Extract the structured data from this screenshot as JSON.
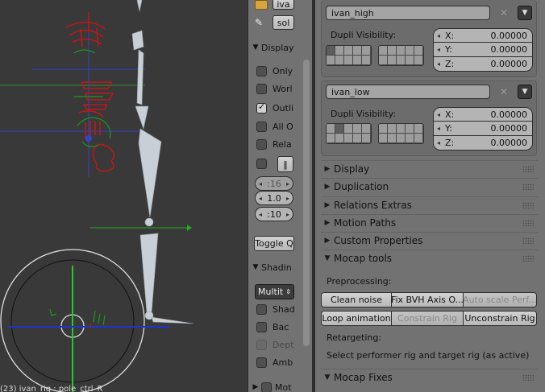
{
  "viewport": {
    "status_text": "(23) ivan_rig : pole_ctrl_R"
  },
  "toolshelf": {
    "top_buttons": [
      {
        "label": "iva",
        "icon": "object-data-icon"
      },
      {
        "label": "sol",
        "icon": "bone-icon"
      }
    ],
    "display_panel": {
      "title": "Display",
      "options": [
        {
          "label": "Only",
          "checked": false
        },
        {
          "label": "Worl",
          "checked": false
        },
        {
          "label": "Outli",
          "checked": true
        },
        {
          "label": "All O",
          "checked": false
        },
        {
          "label": "Rela",
          "checked": false
        },
        {
          "label": "",
          "checked": false
        }
      ],
      "fields": [
        {
          "value": ":16",
          "enabled": false
        },
        {
          "value": "1.0",
          "enabled": true
        },
        {
          "value": ":10",
          "enabled": true
        }
      ],
      "toggle_button": "Toggle Q"
    },
    "shading_panel": {
      "title": "Shadin",
      "mode_select": "Multit",
      "options": [
        {
          "label": "Shad",
          "checked": false
        },
        {
          "label": "Bac",
          "checked": false
        },
        {
          "label": "Dept",
          "checked": false,
          "disabled": true
        },
        {
          "label": "Amb",
          "checked": false
        }
      ]
    },
    "motion_panel": {
      "title": "Mot"
    }
  },
  "properties": {
    "dupli_groups": [
      {
        "name": "ivan_high",
        "visibility_label": "Dupli Visibility:",
        "x": "0.00000",
        "y": "0.00000",
        "z": "0.00000",
        "active_layer": 0
      },
      {
        "name": "ivan_low",
        "visibility_label": "Dupli Visibility:",
        "x": "0.00000",
        "y": "0.00000",
        "z": "0.00000",
        "active_layer": 1
      }
    ],
    "axis_labels": {
      "x": "X:",
      "y": "Y:",
      "z": "Z:"
    },
    "collapsed_panels": [
      "Display",
      "Duplication",
      "Relations Extras",
      "Motion Paths",
      "Custom Properties"
    ],
    "mocap_tools": {
      "title": "Mocap tools",
      "preprocessing_label": "Preprocessing:",
      "row1": [
        {
          "label": "Clean noise",
          "enabled": true
        },
        {
          "label": "Fix BVH Axis O...",
          "enabled": true
        },
        {
          "label": "Auto scale Perf...",
          "enabled": false
        }
      ],
      "row2": [
        {
          "label": "Loop animation",
          "enabled": true
        },
        {
          "label": "Constrain Rig",
          "enabled": false
        },
        {
          "label": "Unconstrain Rig",
          "enabled": true
        }
      ],
      "retargeting_label": "Retargeting:",
      "hint": "Select performer rig and target rig (as active)"
    },
    "mocap_fixes": {
      "title": "Mocap Fixes"
    }
  },
  "colors": {
    "viewport_bg": "#393939",
    "panel_bg": "#727272",
    "axis_x": "#2233cc",
    "axis_y": "#11bb22",
    "rig_red": "#c01818",
    "rig_green": "#1a9a1a",
    "bone": "#c9cfd6"
  }
}
